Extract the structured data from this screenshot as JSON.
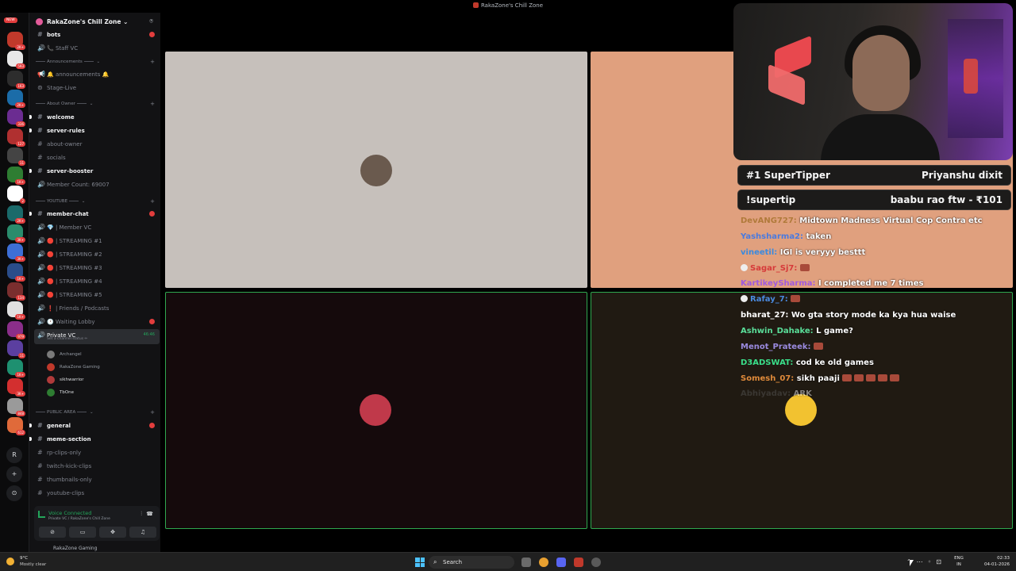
{
  "window": {
    "title": "RakaZone's Chill Zone"
  },
  "server_rail": {
    "new_badge": "NEW",
    "servers": [
      {
        "color": "#c0392b",
        "badge": "2K+"
      },
      {
        "color": "#e8e8e8",
        "badge": "593"
      },
      {
        "color": "#2d2d2d",
        "badge": "163"
      },
      {
        "color": "#1b6ca8",
        "badge": "2K+"
      },
      {
        "color": "#6b2c91",
        "badge": "336"
      },
      {
        "color": "#b03030",
        "badge": "127"
      },
      {
        "color": "#444444",
        "badge": "11"
      },
      {
        "color": "#2e7d32",
        "badge": "1K+"
      },
      {
        "color": "#ffffff",
        "badge": "2"
      },
      {
        "color": "#1a6a6a",
        "badge": "2K+"
      },
      {
        "color": "#2a8c6c",
        "badge": "3K+"
      },
      {
        "color": "#3d6fd6",
        "badge": "3K+"
      },
      {
        "color": "#2a4d8a",
        "badge": "1K+"
      },
      {
        "color": "#7a2e2e",
        "badge": "134"
      },
      {
        "color": "#e0e0e0",
        "badge": "1K+"
      },
      {
        "color": "#8a2e8a",
        "badge": "979"
      },
      {
        "color": "#5b3fa0",
        "badge": "11"
      },
      {
        "color": "#1e9070",
        "badge": "1K+"
      },
      {
        "color": "#d32f2f",
        "badge": "3K+"
      },
      {
        "color": "#9a9a9a",
        "badge": "848"
      },
      {
        "color": "#e06a3a",
        "badge": "612"
      }
    ],
    "text_server": "R",
    "add_server": "+",
    "discover": "⊙"
  },
  "server": {
    "name": "RakaZone's Chill Zone",
    "channels": [
      {
        "label": "bots",
        "icon": "#",
        "style": "bright",
        "mention": ""
      },
      {
        "label": "📞 Staff VC",
        "icon": "🔊",
        "style": "",
        "mention": ""
      }
    ],
    "categories": {
      "announcements": "Announcements",
      "about_owner": "About Owner",
      "youtube": "YOUTUBE",
      "public_area": "PUBLIC AREA"
    },
    "announcement_channels": [
      {
        "label": "🔔 announcements 🔔",
        "icon": "📢"
      },
      {
        "label": "Stage-Live",
        "icon": "📡"
      }
    ],
    "about_channels": [
      {
        "label": "welcome",
        "bright": true
      },
      {
        "label": "server-rules",
        "bright": true
      },
      {
        "label": "about-owner",
        "bright": false
      },
      {
        "label": "socials",
        "bright": false
      },
      {
        "label": "server-booster",
        "bright": true
      },
      {
        "label": "Member Count: 69007",
        "bright": false,
        "voice": true
      }
    ],
    "youtube_channels": [
      {
        "label": "member-chat",
        "bright": true,
        "text": true
      },
      {
        "label": "💎 | Member VC",
        "bright": false
      },
      {
        "label": "🔴 | STREAMING #1",
        "bright": false
      },
      {
        "label": "🔴 | STREAMING #2",
        "bright": false
      },
      {
        "label": "🔴 | STREAMING #3",
        "bright": false
      },
      {
        "label": "🔴 | STREAMING #4",
        "bright": false
      },
      {
        "label": "🔴 | STREAMING #5",
        "bright": false
      },
      {
        "label": "❗ | Friends / Podcasts",
        "bright": false
      },
      {
        "label": "🕐 Waiting Lobby",
        "bright": false
      }
    ],
    "private_vc": {
      "label": "Private VC",
      "timer": "46:46",
      "status": "Set a channel status ✏"
    },
    "vc_members": [
      {
        "name": "Archangel",
        "color": "#7a7a7a",
        "bright": false
      },
      {
        "name": "RakaZone Gaming",
        "color": "#c0392b",
        "bright": false
      },
      {
        "name": "sikhwarrior",
        "color": "#b03a3a",
        "bright": true
      },
      {
        "name": "TbOne",
        "color": "#2e7d32",
        "bright": true
      }
    ],
    "public_channels": [
      {
        "label": "general",
        "bright": true
      },
      {
        "label": "meme-section",
        "bright": true
      },
      {
        "label": "rp-clips-only",
        "bright": false
      },
      {
        "label": "twitch-kick-clips",
        "bright": false
      },
      {
        "label": "thumbnails-only",
        "bright": false
      },
      {
        "label": "youtube-clips",
        "bright": false
      }
    ]
  },
  "voice": {
    "status": "Voice Connected",
    "location": "Private VC / RakaZone's Chill Zone"
  },
  "user": {
    "name": "RakaZone Gaming"
  },
  "stage": {
    "tiles": [
      {
        "bg": "#c6c0bb",
        "avatar": "#6a5a4e"
      },
      {
        "bg": "#e0a07e",
        "avatar": ""
      },
      {
        "bg": "#150a0c",
        "avatar": "#c0394a"
      },
      {
        "bg": "#201a12",
        "avatar": "#f2c230"
      }
    ]
  },
  "overlay": {
    "super_tipper_label": "#1 SuperTipper",
    "super_tipper_name": "Priyanshu dixit",
    "supertip_cmd": "!supertip",
    "supertip_value": "baabu rao ftw - ₹101",
    "chat": [
      {
        "user": "DevANG727:",
        "color": "#b07a3a",
        "text": "Midtown Madness Virtual Cop Contra etc",
        "emotes": 0,
        "prefix": false
      },
      {
        "user": "Yashsharma2:",
        "color": "#4a7adf",
        "text": "taken",
        "emotes": 0,
        "prefix": false
      },
      {
        "user": "vineetil:",
        "color": "#3a8adf",
        "text": "IGI is veryyy besttt",
        "emotes": 0,
        "prefix": false
      },
      {
        "user": "Sagar_Sj7:",
        "color": "#d63a3a",
        "text": "",
        "emotes": 1,
        "prefix": true
      },
      {
        "user": "KartikeySharma:",
        "color": "#a05adf",
        "text": "I completed me 7 times",
        "emotes": 0,
        "prefix": false
      },
      {
        "user": "Rafay_7:",
        "color": "#4a8adf",
        "text": "",
        "emotes": 1,
        "prefix": true
      },
      {
        "user": "bharat_27:",
        "color": "#ffffff",
        "text": "Wo gta story mode ka kya hua waise",
        "emotes": 0,
        "prefix": false
      },
      {
        "user": "Ashwin_Dahake:",
        "color": "#5adf9a",
        "text": "L game?",
        "emotes": 0,
        "prefix": false
      },
      {
        "user": "Menot_Prateek:",
        "color": "#9a8adf",
        "text": "",
        "emotes": 1,
        "prefix": false
      },
      {
        "user": "D3ADSWAT:",
        "color": "#3adf8a",
        "text": "cod ke old games",
        "emotes": 0,
        "prefix": false
      },
      {
        "user": "Somesh_07:",
        "color": "#df8a3a",
        "text": "sikh paaji",
        "emotes": 5,
        "prefix": false
      },
      {
        "user": "Abhiyadav:",
        "color": "#5a5a5a",
        "text": "ARK",
        "emotes": 0,
        "prefix": false
      }
    ]
  },
  "taskbar": {
    "temp": "9°C",
    "condition": "Mostly clear",
    "search": "Search",
    "lang_1": "ENG",
    "lang_2": "IN",
    "time": "02:33",
    "date": "04-01-2026"
  }
}
